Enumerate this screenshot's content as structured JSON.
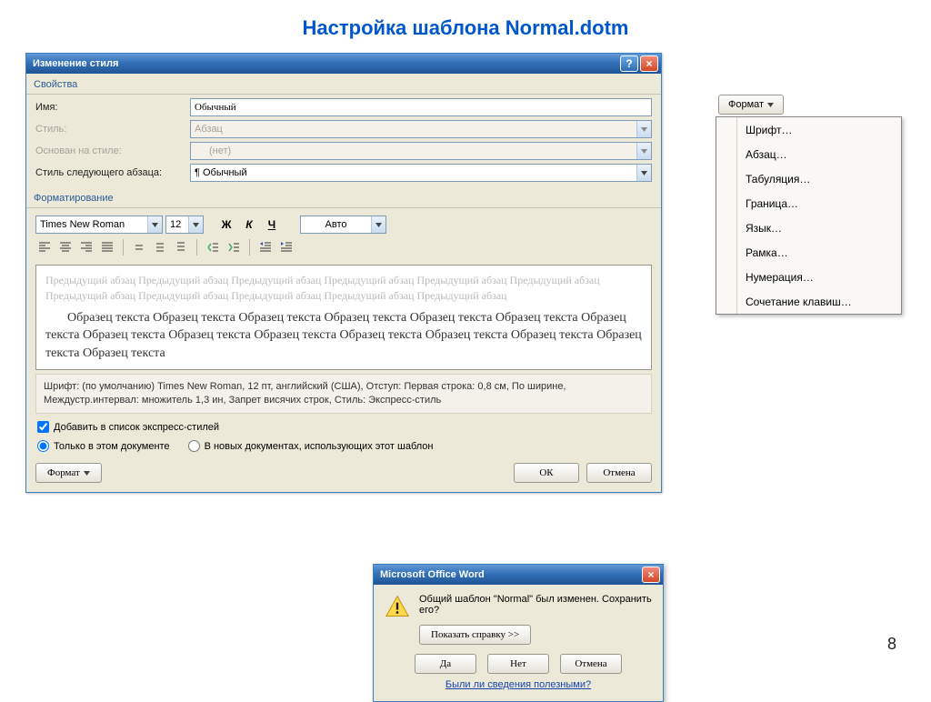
{
  "page": {
    "title": "Настройка шаблона Normal.dotm",
    "number": "8"
  },
  "dialog": {
    "title": "Изменение стиля",
    "section_props": "Свойства",
    "labels": {
      "name": "Имя:",
      "style": "Стиль:",
      "based": "Основан на стиле:",
      "next": "Стиль следующего абзаца:"
    },
    "values": {
      "name": "Обычный",
      "style": "Абзац",
      "based": "(нет)",
      "next": "¶ Обычный"
    },
    "section_format": "Форматирование",
    "font": "Times New Roman",
    "size": "12",
    "bold": "Ж",
    "italic": "К",
    "underline": "Ч",
    "color": "Авто",
    "preview_prev": "Предыдущий абзац Предыдущий абзац Предыдущий абзац Предыдущий абзац Предыдущий абзац Предыдущий абзац Предыдущий абзац Предыдущий абзац Предыдущий абзац Предыдущий абзац Предыдущий абзац",
    "preview_sample": "Образец текста Образец текста Образец текста Образец текста Образец текста Образец текста Образец текста Образец текста Образец текста Образец текста Образец текста Образец текста Образец текста Образец текста Образец текста",
    "description": "Шрифт: (по умолчанию) Times New Roman, 12 пт, английский (США), Отступ: Первая строка: 0,8 см, По ширине, Междустр.интервал: множитель 1,3 ин, Запрет висячих строк, Стиль: Экспресс-стиль",
    "chk_add": "Добавить в список экспресс-стилей",
    "radio_doc": "Только в этом документе",
    "radio_tpl": "В новых документах, использующих этот шаблон",
    "format_btn": "Формат",
    "ok": "ОК",
    "cancel": "Отмена"
  },
  "format_menu": {
    "button": "Формат",
    "items": [
      "Шрифт…",
      "Абзац…",
      "Табуляция…",
      "Граница…",
      "Язык…",
      "Рамка…",
      "Нумерация…",
      "Сочетание клавиш…"
    ]
  },
  "msgbox": {
    "title": "Microsoft Office Word",
    "msg": "Общий шаблон \"Normal\" был изменен. Сохранить его?",
    "show_help": "Показать справку >>",
    "yes": "Да",
    "no": "Нет",
    "cancel": "Отмена",
    "link": "Были ли сведения полезными?"
  }
}
